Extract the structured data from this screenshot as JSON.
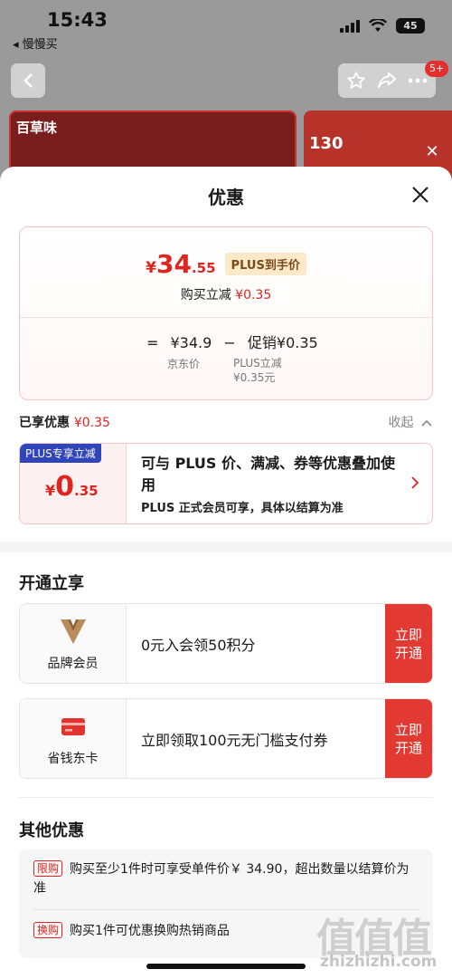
{
  "status_bar": {
    "time": "15:43",
    "back_app": "◂ 慢慢买",
    "battery": "45"
  },
  "nav": {
    "badge": "5+"
  },
  "banners": {
    "left_logo": "百草味",
    "right_num": "130"
  },
  "sheet": {
    "title": "优惠",
    "price": {
      "currency": "¥",
      "int": "34",
      "dec": ".55",
      "plus_tag": "PLUS到手价"
    },
    "reduce": {
      "label": "购买立减",
      "amount": "¥0.35"
    },
    "formula": {
      "eq": "=",
      "jd_price": "¥34.9",
      "minus": "−",
      "promo": "促销¥0.35"
    },
    "captions": {
      "jd_price_label": "京东价",
      "plus_label": "PLUS立减",
      "plus_amount": "¥0.35元"
    },
    "enjoyed": {
      "label": "已享优惠",
      "amount": "¥0.35",
      "collapse": "收起"
    },
    "plus_offer": {
      "tag": "PLUS专享立减",
      "currency": "¥",
      "int": "0",
      "dec": ".35",
      "text": "可与 PLUS 价、满减、券等优惠叠加使用",
      "sub": "PLUS 正式会员可享，具体以结算为准"
    },
    "open_section": {
      "title": "开通立享",
      "items": [
        {
          "label": "品牌会员",
          "text": "0元入会领50积分",
          "button": "立即开通"
        },
        {
          "label": "省钱东卡",
          "text": "立即领取100元无门槛支付券",
          "button": "立即开通"
        }
      ]
    },
    "other_section": {
      "title": "其他优惠",
      "items": [
        {
          "tag": "限购",
          "text": "购买至少1件时可享受单件价￥ 34.90，超出数量以结算价为准"
        },
        {
          "tag": "换购",
          "text": "购买1件可优惠换购热销商品"
        }
      ]
    }
  },
  "watermark": {
    "glyphs": "值值值",
    "url": "zhizhizhi.com"
  },
  "colors": {
    "accent_red": "#e0251f",
    "plus_blue": "#2f45b8",
    "button_red": "#e23a33"
  }
}
